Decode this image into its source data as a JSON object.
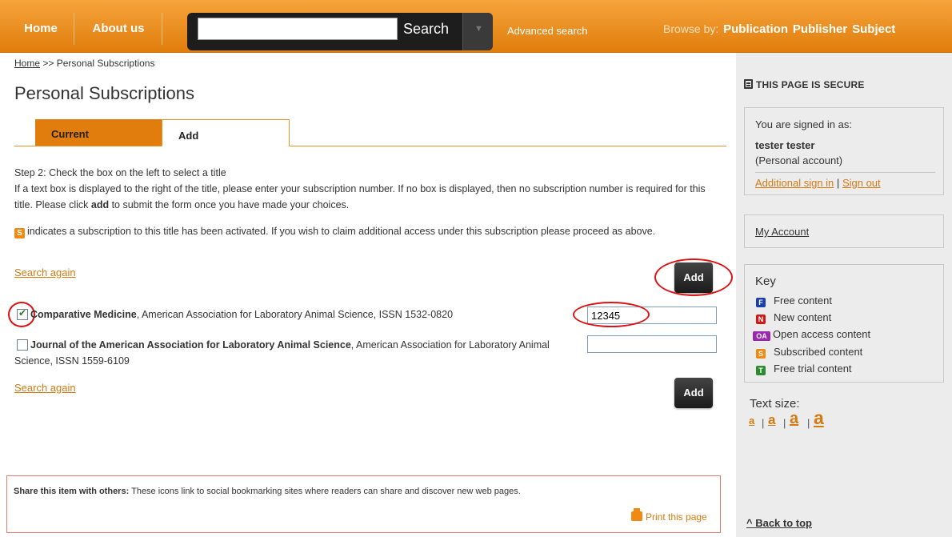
{
  "nav": {
    "home": "Home",
    "about": "About us",
    "search_placeholder": "",
    "search_button": "Search",
    "advanced": "Advanced search",
    "browse_label": "Browse by:",
    "browse_items": [
      "Publication",
      "Publisher",
      "Subject"
    ]
  },
  "breadcrumb": {
    "home": "Home",
    "separator": ">>",
    "current": "Personal Subscriptions"
  },
  "page_title": "Personal Subscriptions",
  "tabs": {
    "current": "Current",
    "add": "Add"
  },
  "instructions": {
    "step": "Step 2: Check the box on the left to select a title",
    "line2_pre": "If a text box is displayed to the right of the title, please enter your subscription number. If no box is displayed, then no subscription number is required for this title. Please click ",
    "line2_bold": "add",
    "line2_post": " to submit the form once you have made your choices.",
    "s_icon": "S",
    "activated": "indicates a subscription to this title has been activated. If you wish to claim additional access under this subscription please proceed as above."
  },
  "search_again": "Search again",
  "add_button": "Add",
  "titles": [
    {
      "name": "Comparative Medicine",
      "details": ", American Association for Laboratory Animal Science, ISSN 1532-0820",
      "checked": true,
      "subscription_number": "12345"
    },
    {
      "name": "Journal of the American Association for Laboratory Animal Science",
      "details": ", American Association for Laboratory Animal Science, ISSN 1559-6109",
      "checked": false,
      "subscription_number": ""
    }
  ],
  "share": {
    "label": "Share this item with others:",
    "text": " These icons link to social bookmarking sites where readers can share and discover new web pages.",
    "print": "Print this page"
  },
  "sidebar": {
    "secure": "THIS PAGE IS SECURE",
    "signed_in_as": "You are signed in as:",
    "user_name": "tester tester",
    "account_type": "(Personal account)",
    "additional_sign_in": "Additional sign in",
    "link_sep": "|",
    "sign_out": "Sign out",
    "my_account": "My Account",
    "key_title": "Key",
    "key_items": [
      {
        "icon": "F",
        "label": "Free content",
        "color": "#1a3fa8"
      },
      {
        "icon": "N",
        "label": "New content",
        "color": "#d01818"
      },
      {
        "icon": "OA",
        "label": "Open access content",
        "color": "#9b27b0"
      },
      {
        "icon": "S",
        "label": "Subscribed content",
        "color": "#f08a10"
      },
      {
        "icon": "T",
        "label": "Free trial content",
        "color": "#2e8a2e"
      }
    ],
    "text_size_label": "Text size:",
    "text_size_glyph": "a",
    "text_size_sep": "|",
    "back_to_top": "^ Back to top"
  },
  "colors": {
    "accent": "#e07d0c",
    "link": "#d57a12",
    "annotation": "#dd1111"
  }
}
